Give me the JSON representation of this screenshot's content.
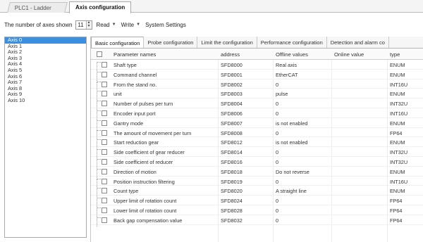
{
  "doc_tabs": [
    {
      "label": "PLC1 - Ladder"
    },
    {
      "label": "Axis configuration"
    }
  ],
  "toolbar": {
    "axes_label": "The number of axes shown",
    "axes_value": "11",
    "read_label": "Read",
    "write_label": "Write",
    "system_settings_label": "System Settings"
  },
  "axis_list": [
    "Axis 0",
    "Axis 1",
    "Axis 2",
    "Axis 3",
    "Axis 4",
    "Axis 5",
    "Axis 6",
    "Axis 7",
    "Axis 8",
    "Axis 9",
    "Axis 10"
  ],
  "selected_axis_index": 0,
  "sub_tabs": [
    {
      "label": "Basic configuration"
    },
    {
      "label": "Probe configuration"
    },
    {
      "label": "Limit the configuration"
    },
    {
      "label": "Performance configuration"
    },
    {
      "label": "Detection and alarm co"
    }
  ],
  "columns": {
    "name": "Parameter names",
    "address": "address",
    "offline": "Offline values",
    "online": "Online value",
    "type": "type"
  },
  "rows": [
    {
      "name": "Shaft type",
      "address": "SFD8000",
      "offline": "Real axis",
      "online": "",
      "type": "ENUM"
    },
    {
      "name": "Command channel",
      "address": "SFD8001",
      "offline": "EtherCAT",
      "online": "",
      "type": "ENUM"
    },
    {
      "name": "From the stand no.",
      "address": "SFD8002",
      "offline": "0",
      "online": "",
      "type": "INT16U"
    },
    {
      "name": "unit",
      "address": "SFD8003",
      "offline": "pulse",
      "online": "",
      "type": "ENUM"
    },
    {
      "name": "Number of pulses per turn",
      "address": "SFD8004",
      "offline": "0",
      "online": "",
      "type": "INT32U"
    },
    {
      "name": "Encoder input port",
      "address": "SFD8006",
      "offline": "0",
      "online": "",
      "type": "INT16U"
    },
    {
      "name": "Gantry mode",
      "address": "SFD8007",
      "offline": "is not enabled",
      "online": "",
      "type": "ENUM"
    },
    {
      "name": "The amount of movement per turn",
      "address": "SFD8008",
      "offline": "0",
      "online": "",
      "type": "FP64"
    },
    {
      "name": "Start reduction gear",
      "address": "SFD8012",
      "offline": "is not enabled",
      "online": "",
      "type": "ENUM"
    },
    {
      "name": "Side coefficient of gear reducer",
      "address": "SFD8014",
      "offline": "0",
      "online": "",
      "type": "INT32U"
    },
    {
      "name": "Side coefficient of reducer",
      "address": "SFD8016",
      "offline": "0",
      "online": "",
      "type": "INT32U"
    },
    {
      "name": "Direction of motion",
      "address": "SFD8018",
      "offline": "Do not reverse",
      "online": "",
      "type": "ENUM"
    },
    {
      "name": "Position instruction filtering",
      "address": "SFD8019",
      "offline": "0",
      "online": "",
      "type": "INT16U"
    },
    {
      "name": "Count type",
      "address": "SFD8020",
      "offline": "A straight line",
      "online": "",
      "type": "ENUM"
    },
    {
      "name": "Upper limit of rotation count",
      "address": "SFD8024",
      "offline": "0",
      "online": "",
      "type": "FP64"
    },
    {
      "name": "Lower limit of rotation count",
      "address": "SFD8028",
      "offline": "0",
      "online": "",
      "type": "FP64"
    },
    {
      "name": "Back gap compensation value",
      "address": "SFD8032",
      "offline": "0",
      "online": "",
      "type": "FP64"
    }
  ],
  "colors": {
    "selection": "#3b8ee0",
    "border": "#a9a9a9"
  }
}
